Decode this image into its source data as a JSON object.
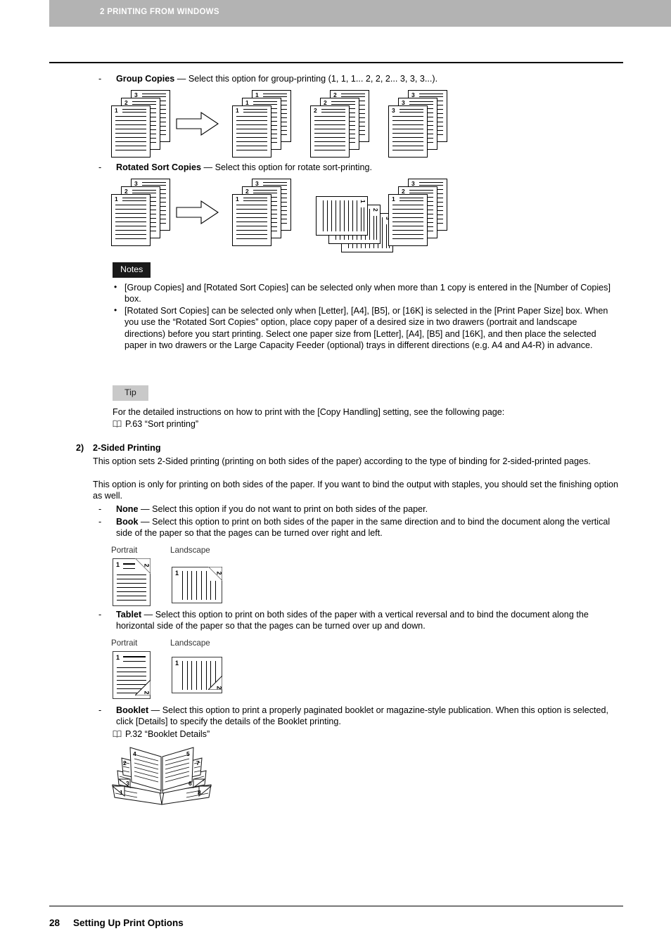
{
  "header": {
    "chapter_label": "2 PRINTING FROM WINDOWS"
  },
  "footer": {
    "page_number": "28",
    "section_title": "Setting Up Print Options"
  },
  "options": {
    "group_copies": {
      "term": "Group Copies",
      "separator": " — ",
      "description": "Select this option for group-printing (1, 1, 1... 2, 2, 2... 3, 3, 3...)."
    },
    "rotated_sort": {
      "term": "Rotated Sort Copies",
      "separator": " — ",
      "description": "Select this option for rotate sort-printing."
    }
  },
  "group_copies_figure": {
    "input_stack": [
      "3",
      "2",
      "1"
    ],
    "arrow": "right-arrow",
    "output_stacks": [
      [
        "1",
        "1",
        "1"
      ],
      [
        "2",
        "2",
        "2"
      ],
      [
        "3",
        "3",
        "3"
      ]
    ]
  },
  "rotated_sort_figure": {
    "input_stack": [
      "3",
      "2",
      "1"
    ],
    "arrow": "right-arrow",
    "output_stacks": [
      {
        "orientation": "portrait",
        "numbers": [
          "3",
          "2",
          "1"
        ]
      },
      {
        "orientation": "landscape",
        "numbers": [
          "1",
          "2",
          "3"
        ]
      },
      {
        "orientation": "portrait",
        "numbers": [
          "3",
          "2",
          "1"
        ]
      }
    ]
  },
  "notes": {
    "label": "Notes",
    "items": [
      "[Group Copies] and [Rotated Sort Copies] can be selected only when more than 1 copy is entered in the [Number of Copies] box.",
      "[Rotated Sort Copies] can be selected only when [Letter], [A4], [B5], or [16K] is selected in the [Print Paper Size] box. When you use the “Rotated Sort Copies” option, place copy paper of a desired size in two drawers (portrait and landscape directions) before you start printing. Select one paper size from [Letter], [A4], [B5] and [16K], and then place the selected paper in two drawers or the Large Capacity Feeder (optional) trays in different directions (e.g. A4 and A4-R) in advance."
    ]
  },
  "tip": {
    "label": "Tip",
    "text": "For the detailed instructions on how to print with the [Copy Handling] setting, see the following page:",
    "reference": "P.63 “Sort printing”",
    "reference_icon": "book-icon"
  },
  "section": {
    "number": "2)",
    "title": "2-Sided Printing",
    "paragraphs": [
      "This option sets 2-Sided printing (printing on both sides of the paper) according to the type of binding for 2-sided-printed pages.",
      "This option is only for printing on both sides of the paper. If you want to bind the output with staples, you should set the finishing option as well."
    ],
    "items": [
      {
        "term": "None",
        "separator": " — ",
        "description": "Select this option if you do not want to print on both sides of the paper."
      },
      {
        "term": "Book",
        "separator": " — ",
        "description": "Select this option to print on both sides of the paper in the same direction and to bind the document along the vertical side of the paper so that the pages can be turned over right and left."
      },
      {
        "term": "Tablet",
        "separator": " — ",
        "description": "Select this option to print on both sides of the paper with a vertical reversal and to bind the document along the horizontal side of the paper so that the pages can be turned over up and down."
      },
      {
        "term": "Booklet",
        "separator": " — ",
        "description": "Select this option to print a properly paginated booklet or magazine-style publication. When this option is selected, click [Details] to specify the details of the Booklet printing."
      }
    ],
    "booklet_reference": "P.32 “Booklet Details”",
    "booklet_reference_icon": "book-icon"
  },
  "book_figure": {
    "portrait_label": "Portrait",
    "landscape_label": "Landscape",
    "portrait_front": "1",
    "portrait_back": "2",
    "landscape_front": "1",
    "landscape_back": "2",
    "fold_position": "top-right"
  },
  "tablet_figure": {
    "portrait_label": "Portrait",
    "landscape_label": "Landscape",
    "portrait_front": "1",
    "portrait_back": "2",
    "landscape_front": "1",
    "landscape_back": "2",
    "fold_position": "bottom-right"
  },
  "booklet_figure": {
    "left_outer": "2",
    "left_inner": "4",
    "left_fold_mid": "3",
    "left_fold_outer": "1",
    "right_inner": "5",
    "right_outer": "7",
    "right_fold_mid": "6",
    "right_fold_outer": "8"
  },
  "colors": {
    "header_band": "#b3b3b3",
    "notes_tag_bg": "#1a1a1a",
    "notes_tag_fg": "#ffffff",
    "tip_tag_bg": "#c9c9c9",
    "tip_tag_fg": "#1a1a1a",
    "rule": "#000000"
  }
}
